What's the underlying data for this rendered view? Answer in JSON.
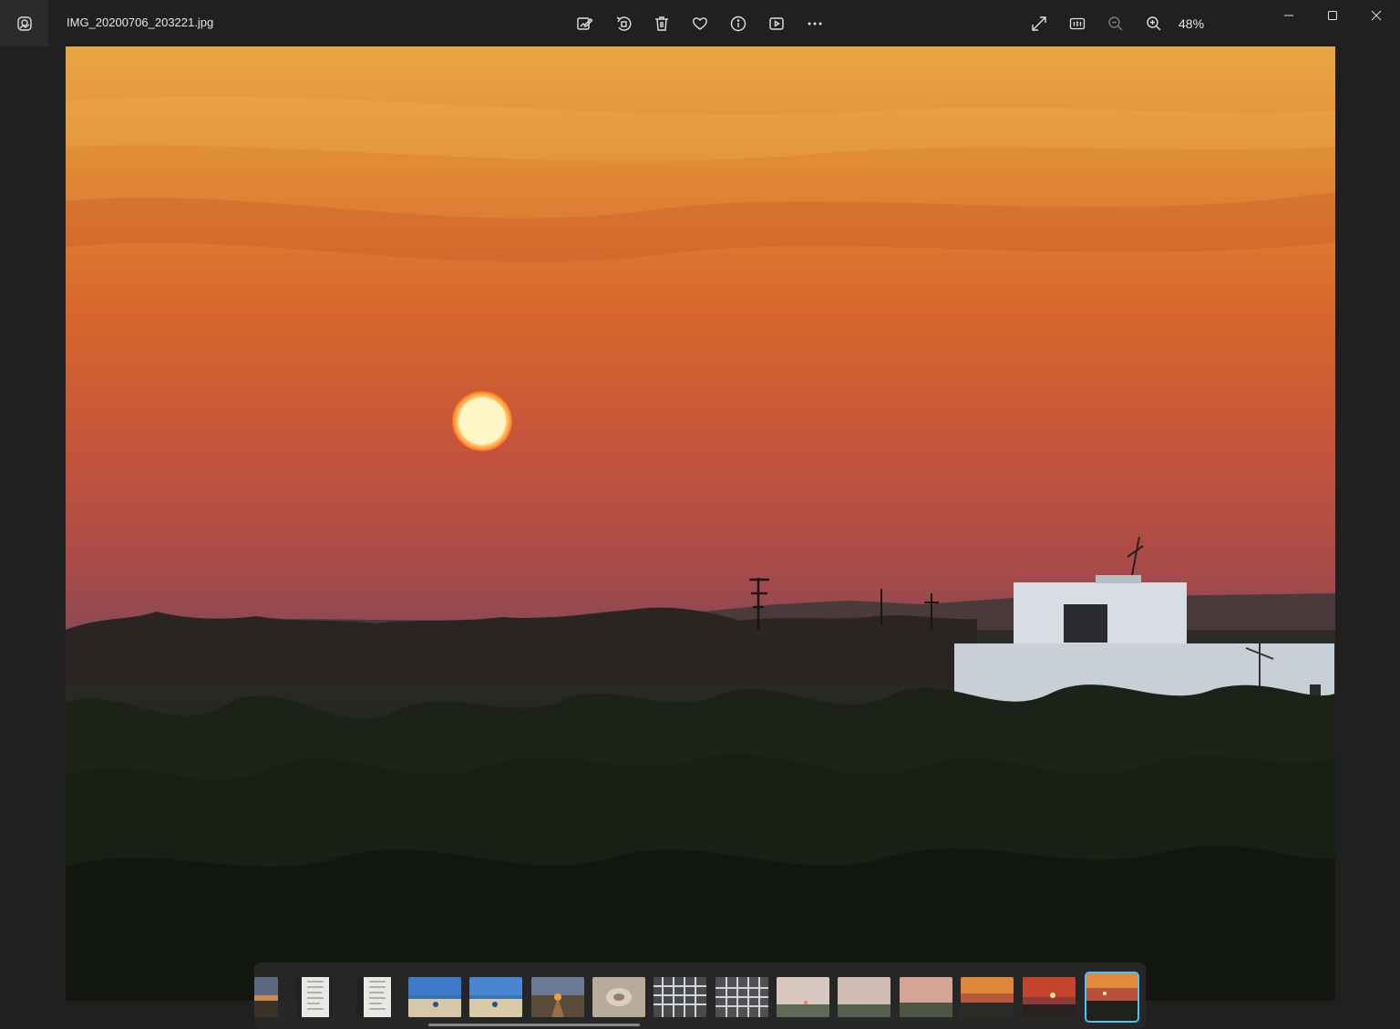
{
  "window": {
    "filename": "IMG_20200706_203221.jpg",
    "zoom_level": "48%"
  },
  "icons": {
    "app": "photos-app-icon",
    "toolbar": [
      "edit-image-icon",
      "rotate-icon",
      "delete-icon",
      "favorite-heart-icon",
      "info-icon",
      "slideshow-icon",
      "more-options-icon"
    ],
    "view": [
      "fullscreen-icon",
      "actual-size-icon",
      "zoom-out-icon",
      "zoom-in-icon"
    ],
    "window_controls": [
      "minimize-icon",
      "maximize-icon",
      "close-icon"
    ]
  },
  "colors": {
    "chrome": "#202020",
    "accent": "#4cc2ff"
  },
  "filmstrip": {
    "thumbnail_count": 15,
    "selected_index": 14
  }
}
